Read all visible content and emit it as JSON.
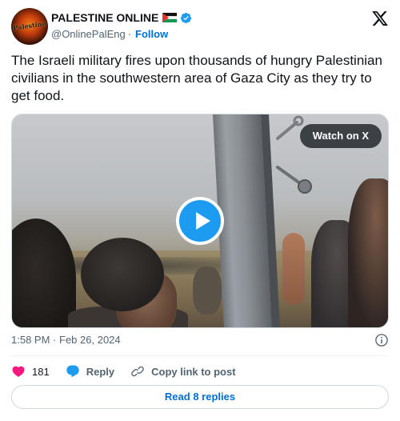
{
  "author": {
    "name": "PALESTINE ONLINE",
    "avatar_text": "Palestine",
    "handle": "@OnlinePalEng",
    "separator": "·",
    "follow_label": "Follow"
  },
  "tweet": {
    "text": "The Israeli military fires upon thousands of hungry Palestinian civilians in the southwestern area of Gaza City as they try to get food."
  },
  "media": {
    "watch_label": "Watch on X"
  },
  "meta": {
    "time": "1:58 PM",
    "separator": "·",
    "date": "Feb 26, 2024"
  },
  "actions": {
    "like_count": "181",
    "reply_label": "Reply",
    "copy_label": "Copy link to post"
  },
  "replies_label": "Read 8 replies",
  "colors": {
    "accent": "#1d9bf0",
    "link": "#006fd6",
    "like": "#f91880",
    "muted": "#536471"
  },
  "icons": {
    "verified": "verified-badge-icon",
    "platform": "x-logo-icon",
    "play": "play-icon",
    "info": "info-icon",
    "like": "heart-icon",
    "reply": "reply-bubble-icon",
    "copy": "link-icon"
  }
}
